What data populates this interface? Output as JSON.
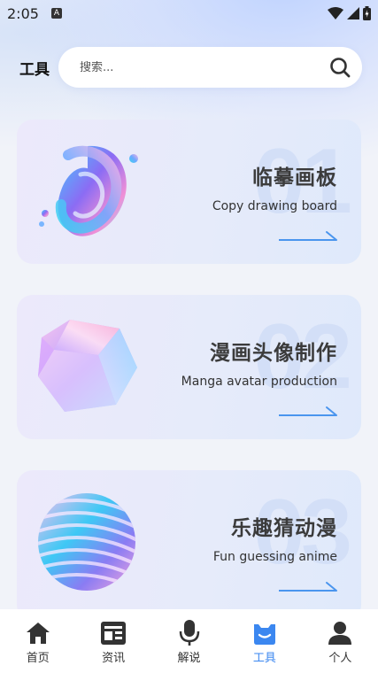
{
  "status_bar": {
    "time": "2:05",
    "notification_letter": "A"
  },
  "header": {
    "title": "工具"
  },
  "search": {
    "placeholder": "搜索..."
  },
  "cards": [
    {
      "number": "01",
      "title": "临摹画板",
      "subtitle": "Copy drawing board"
    },
    {
      "number": "02",
      "title": "漫画头像制作",
      "subtitle": "Manga avatar production"
    },
    {
      "number": "03",
      "title": "乐趣猜动漫",
      "subtitle": "Fun guessing anime"
    }
  ],
  "tabbar": {
    "active_color": "#3b87f0",
    "tabs": [
      {
        "label": "首页",
        "icon": "home-icon"
      },
      {
        "label": "资讯",
        "icon": "news-icon"
      },
      {
        "label": "解说",
        "icon": "microphone-icon"
      },
      {
        "label": "工具",
        "icon": "toolbox-icon",
        "active": true
      },
      {
        "label": "个人",
        "icon": "person-icon"
      }
    ]
  }
}
